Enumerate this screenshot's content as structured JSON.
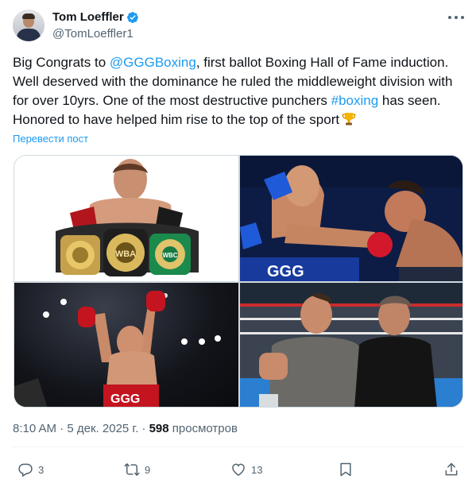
{
  "author": {
    "name": "Tom Loeffler",
    "handle": "@TomLoeffler1"
  },
  "post": {
    "text_before_mention": "Big Congrats to ",
    "mention": "@GGGBoxing",
    "text_mid": ", first ballot Boxing Hall of Fame induction. Well deserved with the dominance he ruled the middleweight division with for over 10yrs. One of the most destructive punchers ",
    "hashtag": "#boxing",
    "text_after_hashtag": " has seen. Honored to have helped him rise to the top of the sport",
    "emoji": "trophy-icon",
    "translate_label": "Перевести пост"
  },
  "photo_overlay_text": {
    "belt_center": "WBA",
    "belt_right": "WBC",
    "trunks_left": "GGG",
    "trunks_ring": "GGG"
  },
  "meta": {
    "time": "8:10 AM",
    "separator": "·",
    "date": "5 дек. 2025 г.",
    "separator2": "·",
    "views_count": "598",
    "views_label": "просмотров"
  },
  "actions": {
    "replies": "3",
    "reposts": "9",
    "likes": "13"
  },
  "colors": {
    "accent": "#1d9bf0",
    "text": "#0f1419",
    "secondary": "#536471",
    "border": "#cfd9de"
  }
}
